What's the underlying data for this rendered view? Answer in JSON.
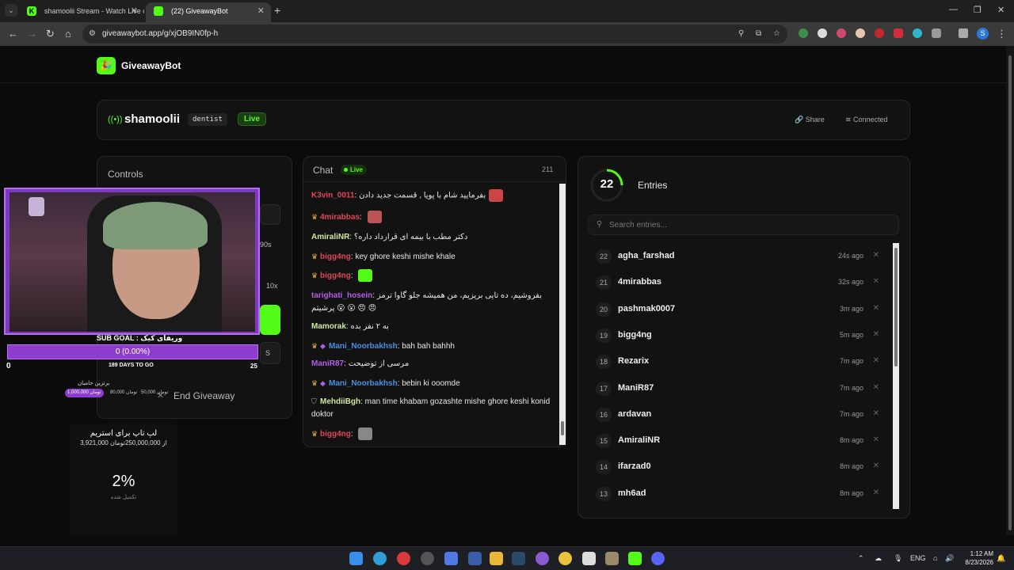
{
  "browser": {
    "tabs": [
      {
        "title": "shamoolii Stream - Watch Live o",
        "active": false
      },
      {
        "title": "(22) GiveawayBot",
        "active": true
      }
    ],
    "url": "giveawaybot.app/g/xjOB9IN0fp-h"
  },
  "brand": {
    "name": "GiveawayBot"
  },
  "stream": {
    "streamer": "shamoolii",
    "category": "dentist",
    "live_label": "Live",
    "share_label": "Share",
    "connected_label": "Connected"
  },
  "controls": {
    "title": "Controls",
    "duration_label": "90s",
    "multiplier_label": "10x",
    "small_label": "S",
    "end_label": "End Giveaway"
  },
  "overlay": {
    "sub_goal_title": "SUB GOAL : وریفای کیک",
    "goal_progress_text": "0 (0.00%)",
    "goal_fraction": 0.0,
    "goal_min": "0",
    "goal_max": "25",
    "goal_days": "189 DAYS TO GO",
    "supporters_title": "برترین حامیان",
    "supporters": [
      {
        "amount": "1,000,000 تومان",
        "color": "#8e3bd0"
      },
      {
        "amount": "80,000 تومان",
        "color": "transparent"
      },
      {
        "amount": "50,000 تومان",
        "color": "transparent"
      }
    ],
    "donation_title": "لپ تاپ برای استریم",
    "donation_sub": "3,921,000 از 250,000,000تومان",
    "donation_percent": "2%",
    "donation_done": "تکمیل شده"
  },
  "chat": {
    "title": "Chat",
    "live_label": "Live",
    "count": "211",
    "messages": [
      {
        "user": "K3vin_0011",
        "color": "#e0475a",
        "badge": "",
        "text": "بفرمایید شام با پویا , قسمت جدید دادن",
        "emote": "#c44"
      },
      {
        "user": "4mirabbas",
        "color": "#e0475a",
        "badge": "crown",
        "text": "",
        "emote": "#b55"
      },
      {
        "user": "AmiraliNR",
        "color": "#cfe8a6",
        "badge": "",
        "text": "دکتر مطب با بیمه ای قرارداد داره؟",
        "emote": ""
      },
      {
        "user": "bigg4ng",
        "color": "#e0475a",
        "badge": "crown",
        "text": "key ghore keshi mishe khale",
        "emote": ""
      },
      {
        "user": "bigg4ng",
        "color": "#e0475a",
        "badge": "crown",
        "text": "",
        "emote": "#53fc18"
      },
      {
        "user": "tarighati_hosein",
        "color": "#b45de6",
        "badge": "",
        "text": "بفروشیم، ده تایی بریزیم، من همیشه جلو گاوا ترمز پرشیتم 😮 😮 😠 😠",
        "emote": ""
      },
      {
        "user": "Mamorak",
        "color": "#cfe8a6",
        "badge": "",
        "text": "به ۲ نفر بده",
        "emote": ""
      },
      {
        "user": "Mani_Noorbakhsh",
        "color": "#4a90e2",
        "badge": "crown-gem",
        "text": "bah bah bahhh",
        "emote": ""
      },
      {
        "user": "ManiR87",
        "color": "#b45de6",
        "badge": "",
        "text": "مرسی از توضیحت",
        "emote": ""
      },
      {
        "user": "Mani_Noorbakhsh",
        "color": "#4a90e2",
        "badge": "crown-gem",
        "text": "bebin ki ooomde",
        "emote": ""
      },
      {
        "user": "MehdiiBgh",
        "color": "#cfe8a6",
        "badge": "shield",
        "text": "man time khabam gozashte mishe ghore keshi konid doktor",
        "emote": ""
      },
      {
        "user": "bigg4ng",
        "color": "#e0475a",
        "badge": "crown",
        "text": "",
        "emote": "#888"
      }
    ]
  },
  "entries": {
    "count": "22",
    "title": "Entries",
    "search_placeholder": "Search entries...",
    "list": [
      {
        "num": "22",
        "name": "agha_farshad",
        "time": "24s ago"
      },
      {
        "num": "21",
        "name": "4mirabbas",
        "time": "32s ago"
      },
      {
        "num": "20",
        "name": "pashmak0007",
        "time": "3m ago"
      },
      {
        "num": "19",
        "name": "bigg4ng",
        "time": "5m ago"
      },
      {
        "num": "18",
        "name": "Rezarix",
        "time": "7m ago"
      },
      {
        "num": "17",
        "name": "ManiR87",
        "time": "7m ago"
      },
      {
        "num": "16",
        "name": "ardavan",
        "time": "7m ago"
      },
      {
        "num": "15",
        "name": "AmiraliNR",
        "time": "8m ago"
      },
      {
        "num": "14",
        "name": "ifarzad0",
        "time": "8m ago"
      },
      {
        "num": "13",
        "name": "mh6ad",
        "time": "8m ago"
      }
    ]
  },
  "taskbar": {
    "lang": "ENG",
    "time": "1:12 AM",
    "date": "8/23/2026"
  },
  "colors": {
    "accent": "#53fc18",
    "overlay_purple": "#8e3bd0",
    "card_bg": "#121212"
  }
}
